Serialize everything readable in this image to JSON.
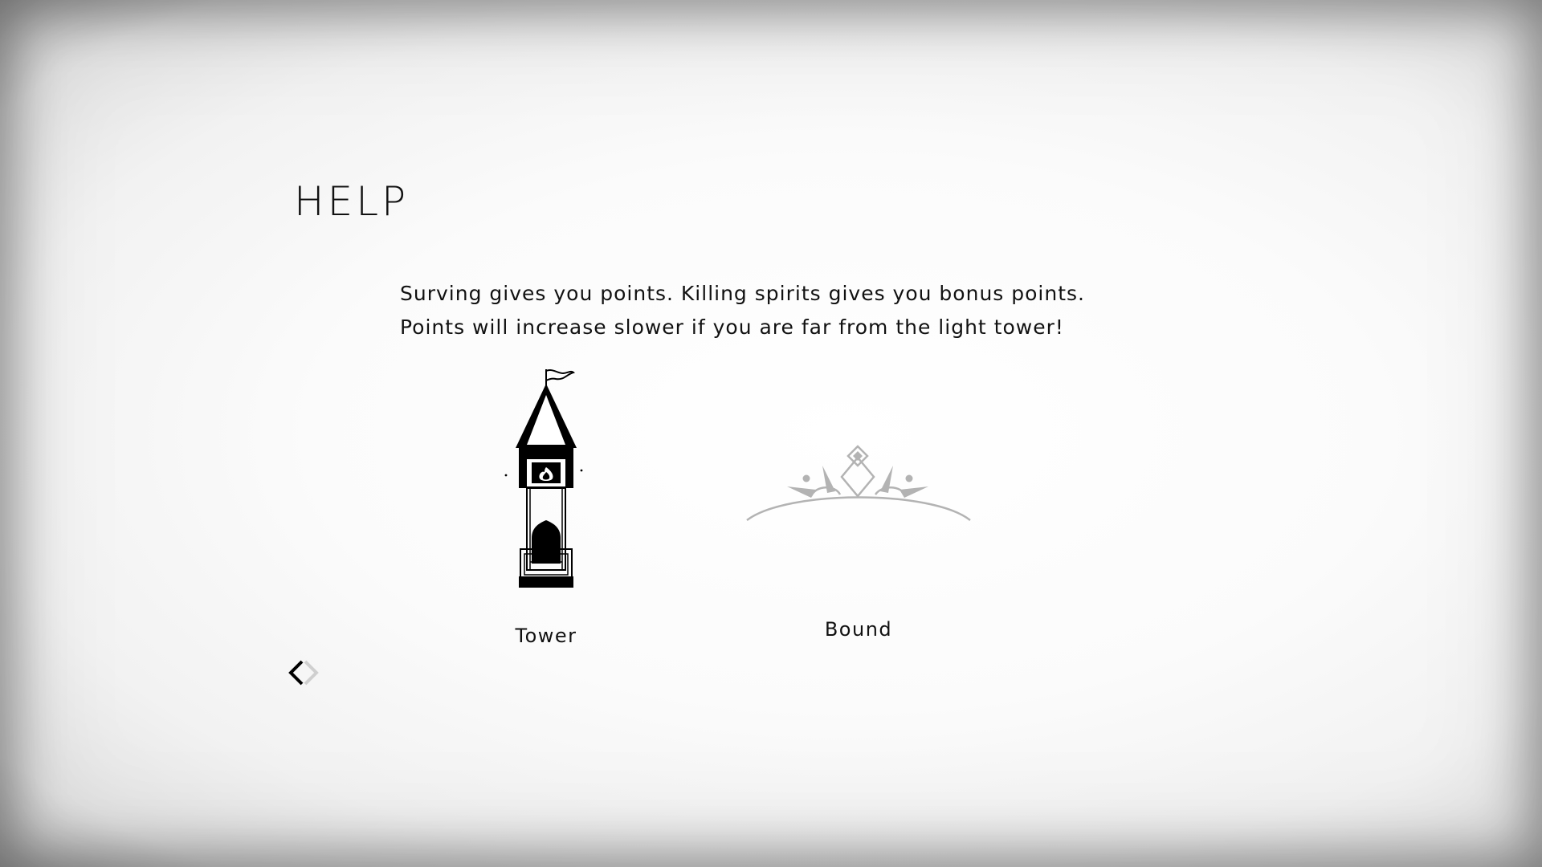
{
  "help": {
    "title": "HELP",
    "description": [
      "Surving gives you points. Killing spirits gives you bonus points.",
      "Points will increase slower if you are far from the light tower!"
    ]
  },
  "items": [
    {
      "label": "Tower",
      "icon": "light-tower-icon"
    },
    {
      "label": "Bound",
      "icon": "bound-icon"
    }
  ],
  "navigation": {
    "back_icon": "back-arrow-icon"
  },
  "colors": {
    "background": "#fafafa",
    "text": "#111111",
    "bound_gray": "#b3b3b3"
  }
}
